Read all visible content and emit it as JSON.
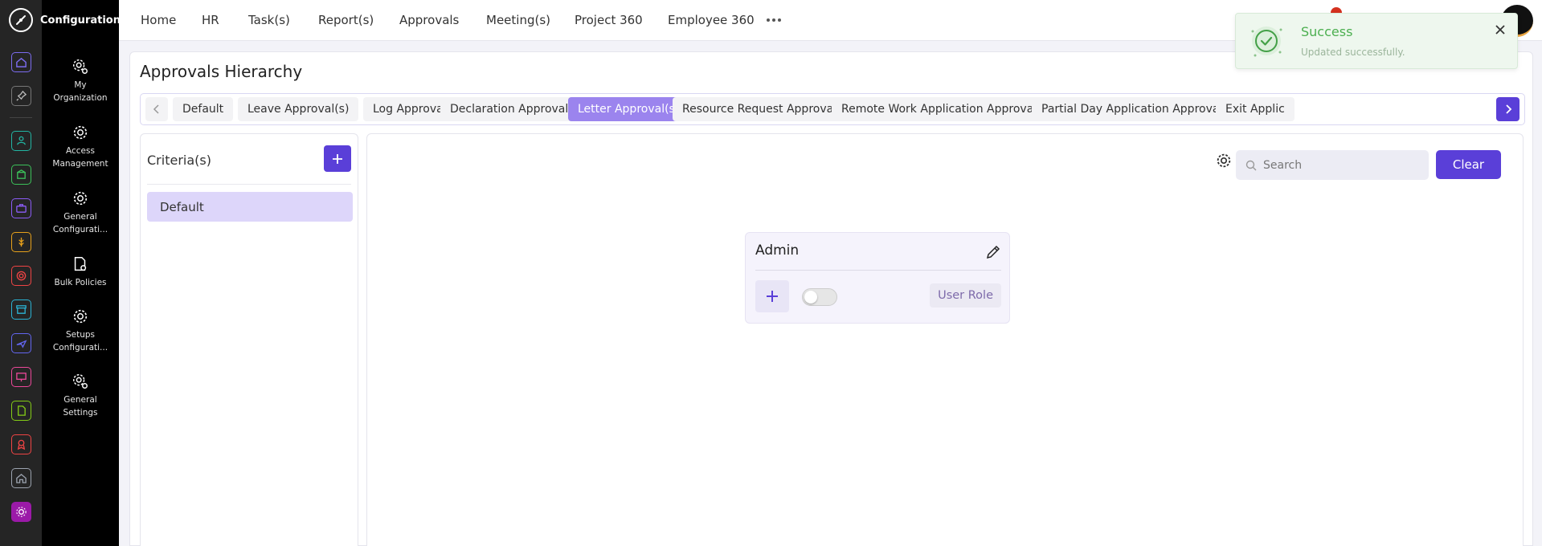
{
  "sidebar": {
    "title": "Configuration",
    "items": [
      {
        "label": "My Organization"
      },
      {
        "label": "Access Management"
      },
      {
        "label": "General Configurati..."
      },
      {
        "label": "Bulk Policies"
      },
      {
        "label": "Setups Configurati..."
      },
      {
        "label": "General Settings"
      }
    ]
  },
  "rail": {
    "icons": [
      {
        "name": "home-icon",
        "color": "#7c6cf0"
      },
      {
        "name": "pin-icon",
        "color": "#bbbbbb"
      },
      {
        "name": "team-icon",
        "color": "#22b5a3"
      },
      {
        "name": "box-icon",
        "color": "#3cc15a"
      },
      {
        "name": "briefcase-icon",
        "color": "#8b5cf6"
      },
      {
        "name": "wheat-icon",
        "color": "#e7a11b"
      },
      {
        "name": "target-icon",
        "color": "#ef4444"
      },
      {
        "name": "archive-icon",
        "color": "#2bb3d4"
      },
      {
        "name": "plane-icon",
        "color": "#6366f1"
      },
      {
        "name": "presentation-icon",
        "color": "#ec4899"
      },
      {
        "name": "document-icon",
        "color": "#84cc16"
      },
      {
        "name": "award-icon",
        "color": "#ef4444"
      },
      {
        "name": "house-icon",
        "color": "#9ca3af"
      },
      {
        "name": "settings-icon",
        "color": "#d946ef"
      }
    ]
  },
  "topnav": {
    "items": [
      "Home",
      "HR",
      "Task(s)",
      "Report(s)",
      "Approvals",
      "Meeting(s)",
      "Project 360",
      "Employee 360"
    ]
  },
  "page": {
    "title": "Approvals Hierarchy"
  },
  "tabs": {
    "items": [
      "Default",
      "Leave Approval(s)",
      "Log Approval(s)",
      "Declaration Approval(s)",
      "Letter Approval(s)",
      "Resource Request Approval(s)",
      "Remote Work Application Approval(s)",
      "Partial Day Application Approval(s)",
      "Exit Applic"
    ],
    "active_index": 4
  },
  "criteria": {
    "title": "Criteria(s)",
    "items": [
      "Default"
    ]
  },
  "hierarchy": {
    "search_placeholder": "Search",
    "clear_label": "Clear",
    "node": {
      "title": "Admin",
      "role_label": "User Role",
      "toggle_on": false
    }
  },
  "toast": {
    "title": "Success",
    "message": "Updated successfully."
  },
  "colors": {
    "primary": "#5a3fd8",
    "active_tab": "#9b84ee",
    "success": "#4caf50"
  }
}
